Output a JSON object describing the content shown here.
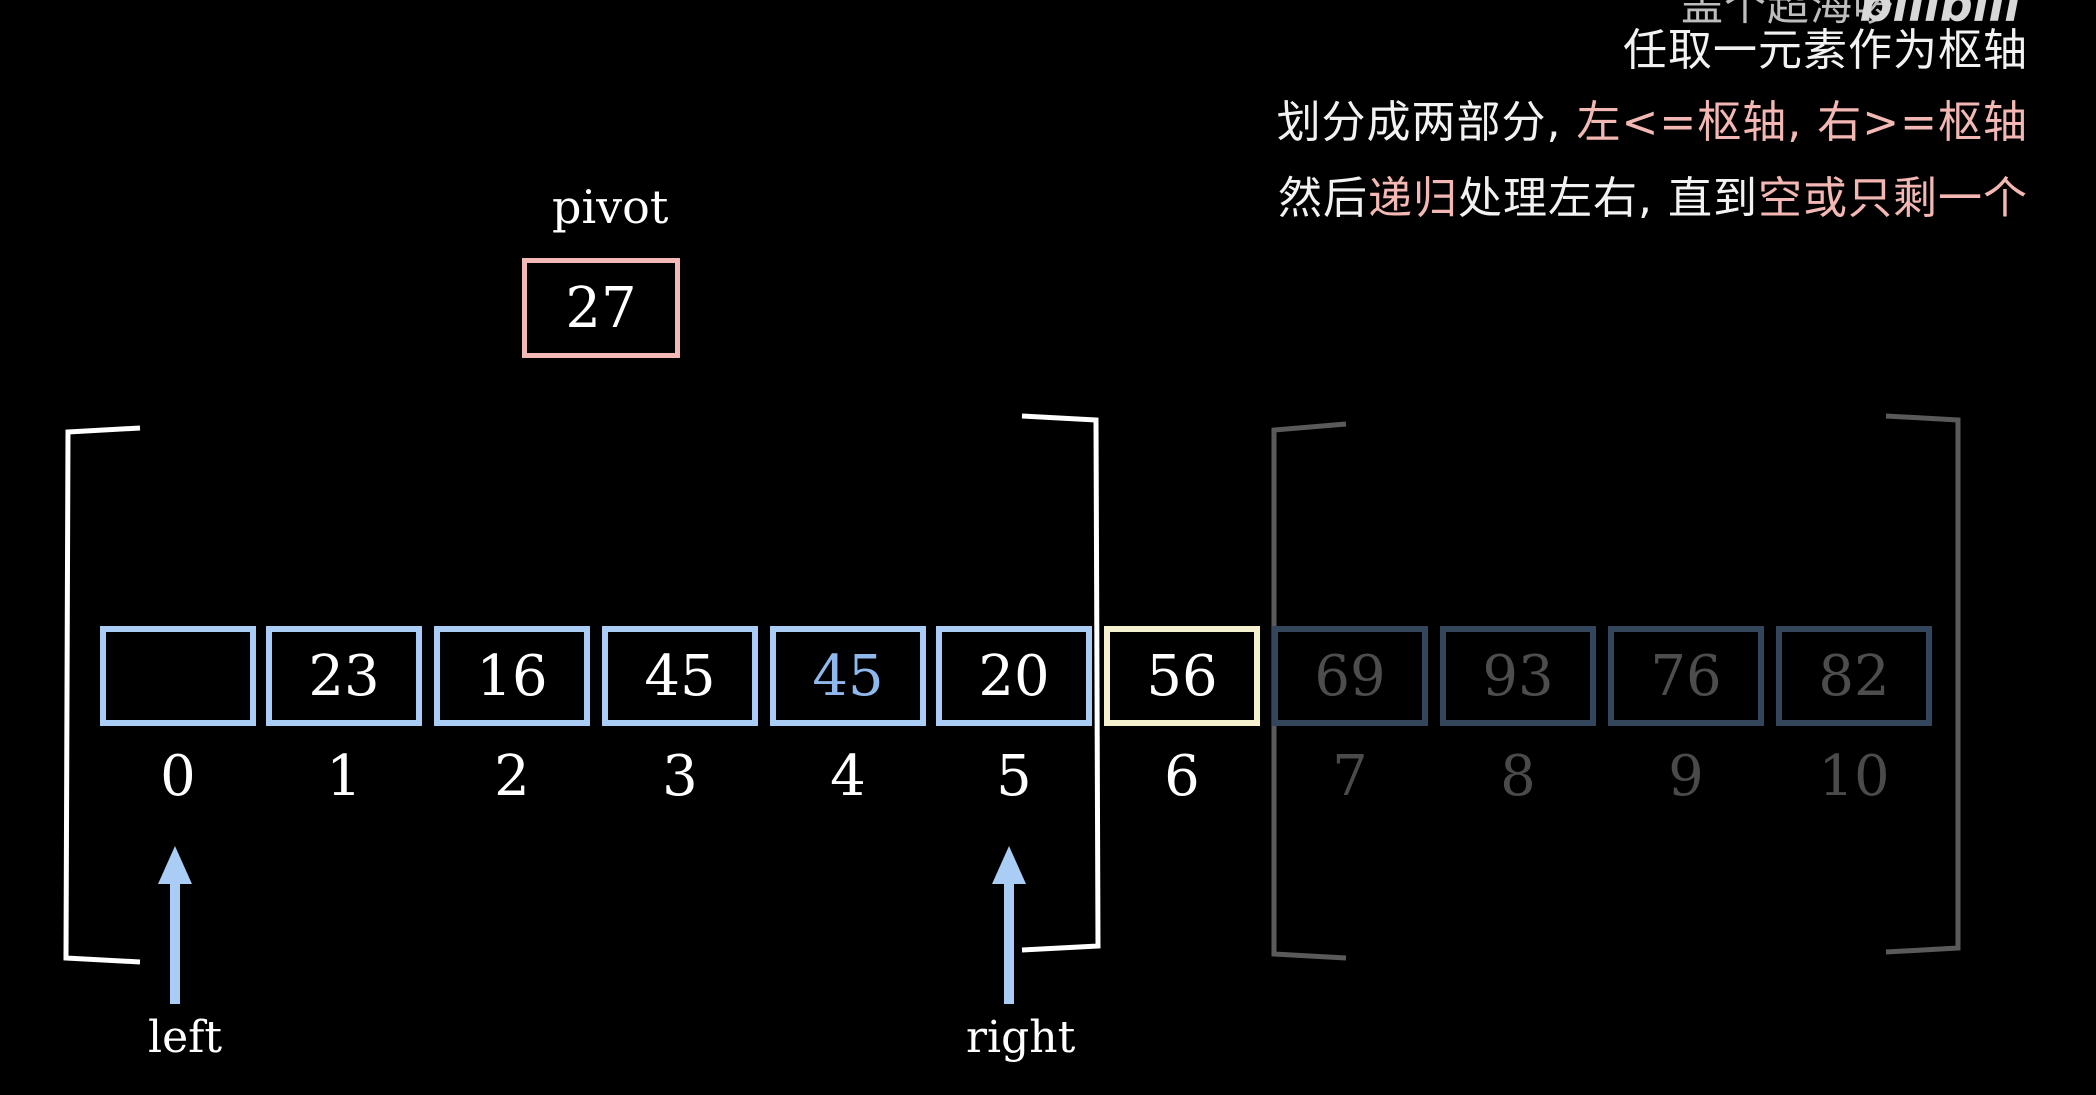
{
  "captions": {
    "top_cut": "盖个超海啰",
    "logo": "bilibili",
    "line1": "任取一元素作为枢轴",
    "line2_a": "划分成两部分, ",
    "line2_b": "左<=枢轴, 右>=枢轴",
    "line3_a": "然后",
    "line3_b": "递归",
    "line3_c": "处理左右, 直到",
    "line3_d": "空或只剩一个"
  },
  "pivot": {
    "label": "pivot",
    "value": "27"
  },
  "cells": [
    {
      "index": "0",
      "value": "",
      "state": "active"
    },
    {
      "index": "1",
      "value": "23",
      "state": "active"
    },
    {
      "index": "2",
      "value": "16",
      "state": "active"
    },
    {
      "index": "3",
      "value": "45",
      "state": "active"
    },
    {
      "index": "4",
      "value": "45",
      "state": "active-blue"
    },
    {
      "index": "5",
      "value": "20",
      "state": "active"
    },
    {
      "index": "6",
      "value": "56",
      "state": "pivot-slot"
    },
    {
      "index": "7",
      "value": "69",
      "state": "dim"
    },
    {
      "index": "8",
      "value": "93",
      "state": "dim"
    },
    {
      "index": "9",
      "value": "76",
      "state": "dim"
    },
    {
      "index": "10",
      "value": "82",
      "state": "dim"
    }
  ],
  "pointers": {
    "left": "left",
    "right": "right"
  },
  "colors": {
    "active_border": "#a9cdf5",
    "pivot_border": "#f2b9b6",
    "placed_border": "#f6f1cf",
    "dim_border": "#34465c",
    "arrow": "#a9cdf5"
  }
}
